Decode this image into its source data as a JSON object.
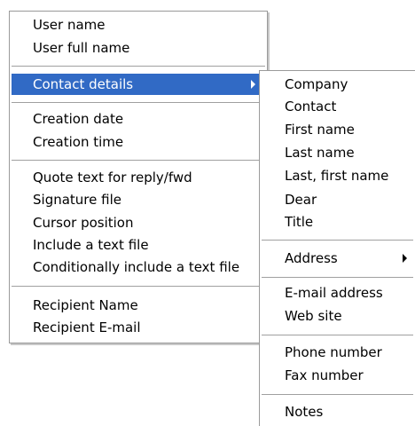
{
  "main_menu": {
    "group1": [
      "User name",
      "User full name"
    ],
    "group2": [
      "Contact details"
    ],
    "group3": [
      "Creation date",
      "Creation time"
    ],
    "group4": [
      "Quote text for reply/fwd",
      "Signature file",
      "Cursor position",
      "Include a text file",
      "Conditionally include a text file"
    ],
    "group5": [
      "Recipient Name",
      "Recipient E-mail"
    ]
  },
  "submenu": {
    "group1": [
      "Company",
      "Contact",
      "First name",
      "Last name",
      "Last, first name",
      "Dear",
      "Title"
    ],
    "group2": [
      "Address"
    ],
    "group3": [
      "E-mail address",
      "Web site"
    ],
    "group4": [
      "Phone number",
      "Fax number"
    ],
    "group5": [
      "Notes"
    ]
  },
  "highlight_color": "#316ac5"
}
